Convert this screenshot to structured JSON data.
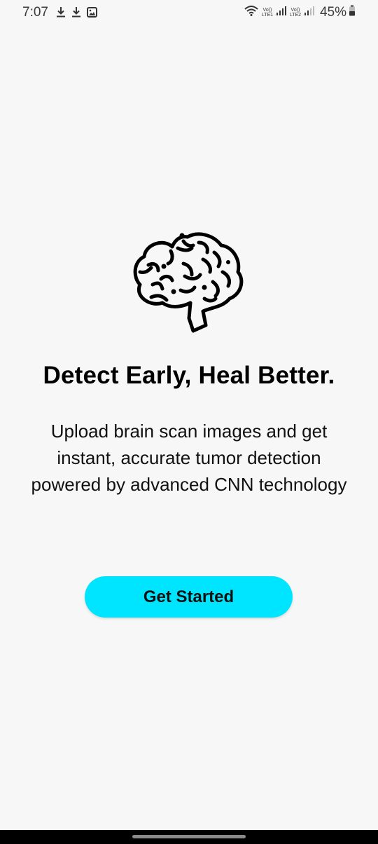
{
  "status_bar": {
    "time": "7:07",
    "battery": "45%",
    "sim1_label": "LTE1",
    "sim2_label": "LTE2",
    "volte_label": "Vo))",
    "icons": [
      "download-icon",
      "download-icon",
      "image-icon",
      "wifi-icon",
      "signal-icon",
      "signal-icon",
      "battery-icon"
    ]
  },
  "hero": {
    "icon": "brain-icon",
    "headline": "Detect Early, Heal Better.",
    "subtext": "Upload brain scan images and get instant, accurate tumor detection powered by advanced CNN technology"
  },
  "cta": {
    "label": "Get Started",
    "color": "#00e5ff"
  },
  "theme": {
    "background": "#f7f7f7",
    "text": "#000000"
  }
}
